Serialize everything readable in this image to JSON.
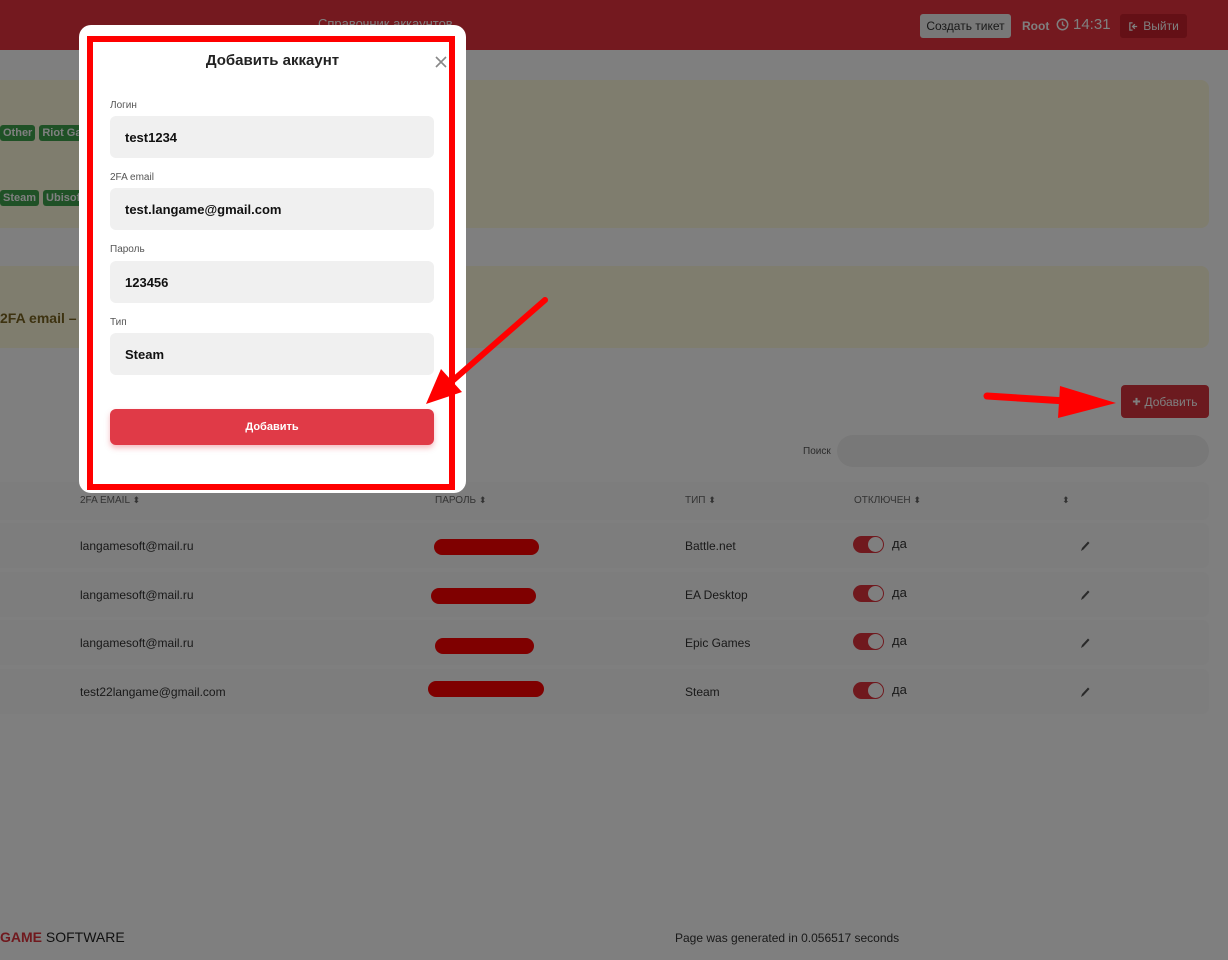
{
  "header": {
    "title": "Справочник аккаунтов",
    "ticket_button": "Создать тикет",
    "user": "Root",
    "time": "14:31",
    "logout": "Выйти",
    "clock_icon": "clock-icon",
    "logout_icon": "sign-out-icon"
  },
  "info": {
    "tags_row1": [
      "Other",
      "Riot Ga"
    ],
    "tags_row2": [
      "Steam",
      "Ubisof"
    ],
    "line2": "2FA email – "
  },
  "toolbar": {
    "add_label": "Добавить",
    "add_icon": "plus-icon",
    "search_label": "Поиск",
    "search_value": ""
  },
  "table": {
    "columns": [
      "2FA EMAIL",
      "ПАРОЛЬ",
      "ТИП",
      "ОТКЛЮЧЕН",
      ""
    ],
    "rows": [
      {
        "email": "langamesoft@mail.ru",
        "type": "Battle.net",
        "disabled": "да"
      },
      {
        "email": "langamesoft@mail.ru",
        "type": "EA Desktop",
        "disabled": "да"
      },
      {
        "email": "langamesoft@mail.ru",
        "type": "Epic Games",
        "disabled": "да"
      },
      {
        "email": "test22langame@gmail.com",
        "type": "Steam",
        "disabled": "да"
      }
    ]
  },
  "footer": {
    "logo_bold": "GAME",
    "logo_rest": " SOFTWARE",
    "generated": "Page was generated in 0.056517 seconds"
  },
  "modal": {
    "title": "Добавить аккаунт",
    "fields": {
      "login": {
        "label": "Логин",
        "value": "test1234"
      },
      "email": {
        "label": "2FA email",
        "value": "test.langame@gmail.com"
      },
      "password": {
        "label": "Пароль",
        "value": "123456"
      },
      "type": {
        "label": "Тип",
        "value": "Steam"
      }
    },
    "submit": "Добавить"
  },
  "colors": {
    "brand_red": "#e8333f",
    "annotation_red": "#ff0000",
    "tag_green": "#3fa34d"
  }
}
